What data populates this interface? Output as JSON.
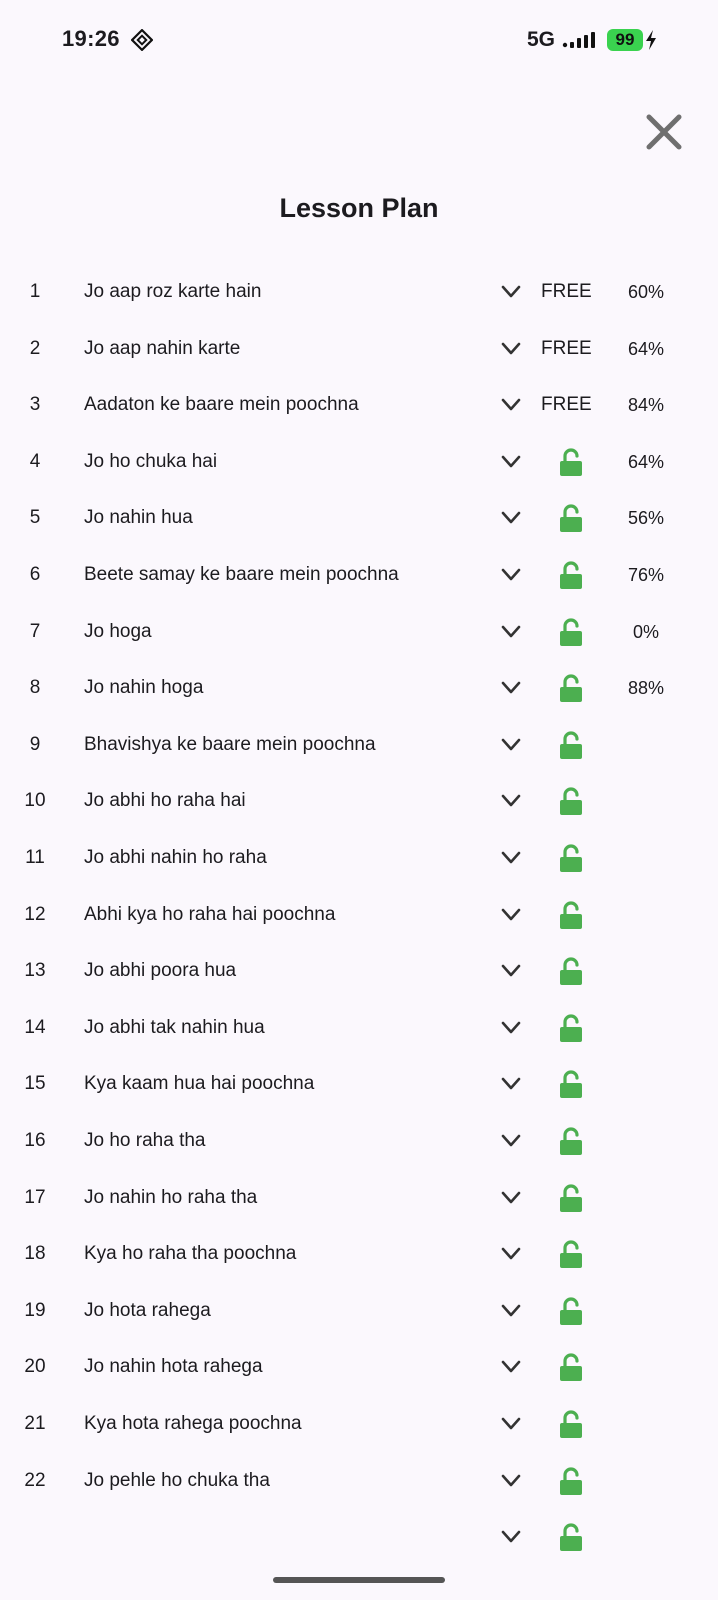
{
  "status_bar": {
    "time": "19:26",
    "network": "5G",
    "battery": "99"
  },
  "header": {
    "title": "Lesson Plan",
    "close_icon": "close-icon"
  },
  "colors": {
    "accent_unlock": "#4caf50",
    "text": "#1c1b1f",
    "background": "#fbf8fd"
  },
  "lessons": [
    {
      "num": "1",
      "name": "Jo aap roz karte hain",
      "access": "FREE",
      "score": "60%"
    },
    {
      "num": "2",
      "name": "Jo aap nahin karte",
      "access": "FREE",
      "score": "64%"
    },
    {
      "num": "3",
      "name": "Aadaton ke baare mein poochna",
      "access": "FREE",
      "score": "84%"
    },
    {
      "num": "4",
      "name": "Jo ho chuka hai",
      "access": "unlocked",
      "score": "64%"
    },
    {
      "num": "5",
      "name": "Jo nahin hua",
      "access": "unlocked",
      "score": "56%"
    },
    {
      "num": "6",
      "name": "Beete samay ke baare mein poochna",
      "access": "unlocked",
      "score": "76%"
    },
    {
      "num": "7",
      "name": "Jo hoga",
      "access": "unlocked",
      "score": "0%"
    },
    {
      "num": "8",
      "name": "Jo nahin hoga",
      "access": "unlocked",
      "score": "88%"
    },
    {
      "num": "9",
      "name": "Bhavishya ke baare mein poochna",
      "access": "unlocked",
      "score": ""
    },
    {
      "num": "10",
      "name": "Jo abhi ho raha hai",
      "access": "unlocked",
      "score": ""
    },
    {
      "num": "11",
      "name": "Jo abhi nahin ho raha",
      "access": "unlocked",
      "score": ""
    },
    {
      "num": "12",
      "name": "Abhi kya ho raha hai poochna",
      "access": "unlocked",
      "score": ""
    },
    {
      "num": "13",
      "name": "Jo abhi poora hua",
      "access": "unlocked",
      "score": ""
    },
    {
      "num": "14",
      "name": "Jo abhi tak nahin hua",
      "access": "unlocked",
      "score": ""
    },
    {
      "num": "15",
      "name": "Kya kaam hua hai poochna",
      "access": "unlocked",
      "score": ""
    },
    {
      "num": "16",
      "name": "Jo ho raha tha",
      "access": "unlocked",
      "score": ""
    },
    {
      "num": "17",
      "name": "Jo nahin ho raha tha",
      "access": "unlocked",
      "score": ""
    },
    {
      "num": "18",
      "name": "Kya ho raha tha poochna",
      "access": "unlocked",
      "score": ""
    },
    {
      "num": "19",
      "name": "Jo hota rahega",
      "access": "unlocked",
      "score": ""
    },
    {
      "num": "20",
      "name": "Jo nahin hota rahega",
      "access": "unlocked",
      "score": ""
    },
    {
      "num": "21",
      "name": "Kya hota rahega poochna",
      "access": "unlocked",
      "score": ""
    },
    {
      "num": "22",
      "name": "Jo pehle ho chuka tha",
      "access": "unlocked",
      "score": ""
    },
    {
      "num": "",
      "name": "",
      "access": "unlocked",
      "score": ""
    }
  ]
}
